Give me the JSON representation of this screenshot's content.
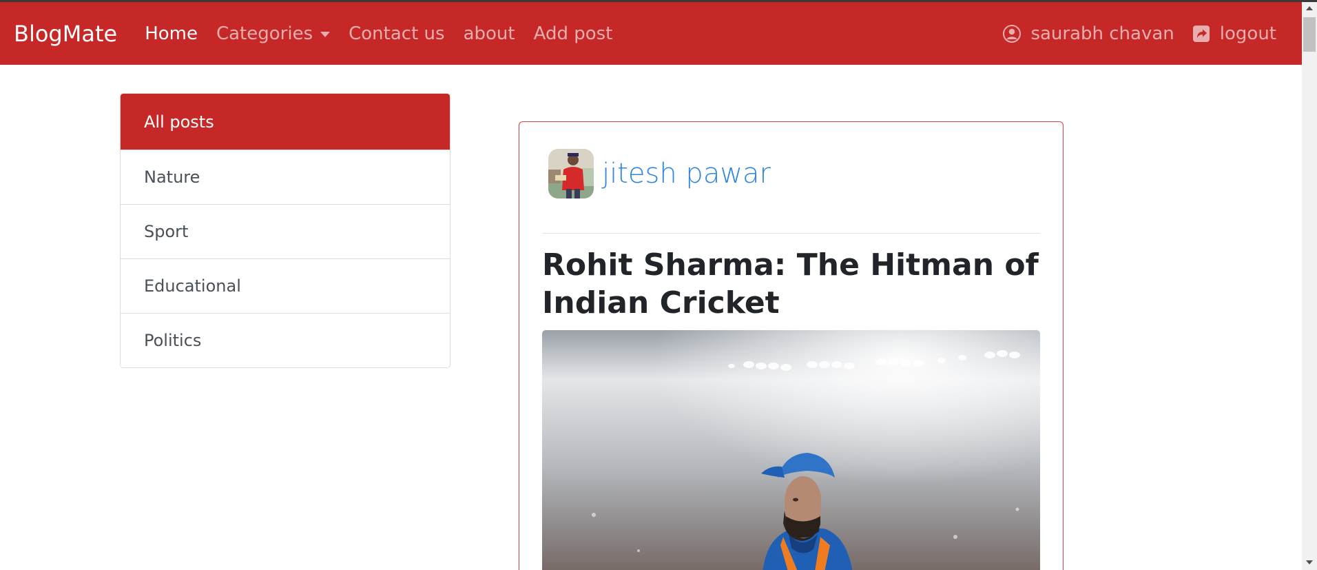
{
  "navbar": {
    "brand": "BlogMate",
    "links": [
      "Home",
      "Categories",
      "Contact us",
      "about",
      "Add post"
    ],
    "user_label": "saurabh chavan",
    "logout_label": "logout"
  },
  "sidebar": {
    "items": [
      {
        "label": "All posts"
      },
      {
        "label": "Nature"
      },
      {
        "label": "Sport"
      },
      {
        "label": "Educational"
      },
      {
        "label": "Politics"
      }
    ]
  },
  "post": {
    "author": "jitesh pawar",
    "title": "Rohit Sharma: The Hitman of Indian Cricket"
  },
  "colors": {
    "navbar": "#c62828",
    "author_link": "#2f86e0",
    "card_border": "#d4414a"
  },
  "icons": {
    "user": "user-circle-icon",
    "logout": "share-square-icon",
    "dropdown": "caret-down-icon"
  }
}
